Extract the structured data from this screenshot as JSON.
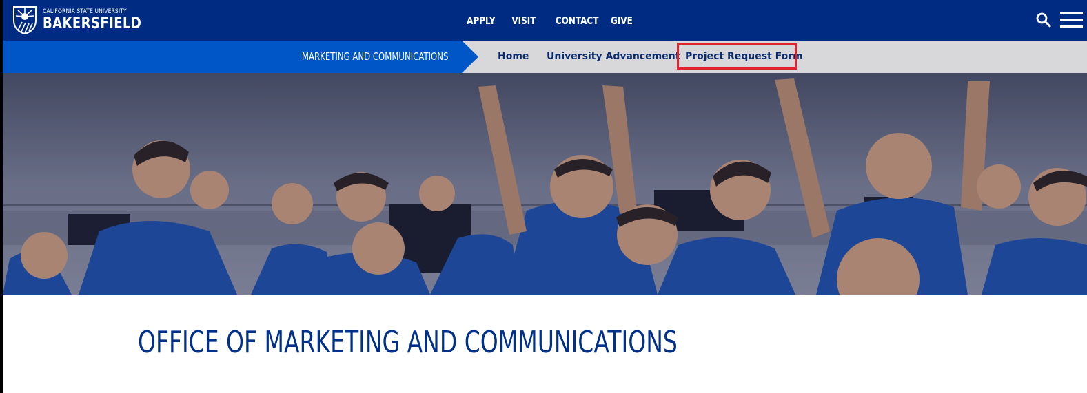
{
  "brand": {
    "small_text": "CALIFORNIA STATE UNIVERSITY",
    "big_text": "BAKERSFIELD"
  },
  "topnav": {
    "items": [
      {
        "label": "APPLY"
      },
      {
        "label": "VISIT"
      },
      {
        "label": "CONTACT"
      },
      {
        "label": "GIVE"
      }
    ]
  },
  "subnav": {
    "section_title": "MARKETING AND COMMUNICATIONS",
    "links": [
      {
        "label": "Home"
      },
      {
        "label": "University Advancement"
      },
      {
        "label": "Project Request Form",
        "highlighted": true
      }
    ]
  },
  "page": {
    "title": "OFFICE OF MARKETING AND COMMUNICATIONS"
  },
  "icons": {
    "logo": "csub-sunburst-shield-icon",
    "search": "search-icon",
    "menu": "hamburger-menu-icon"
  },
  "colors": {
    "header_bg": "#002b82",
    "subnav_title_bg": "#0056c6",
    "subnav_bg": "#d8d8da",
    "link_text": "#0a2a6e",
    "highlight_border": "#e0232e",
    "title_text": "#00308a"
  }
}
